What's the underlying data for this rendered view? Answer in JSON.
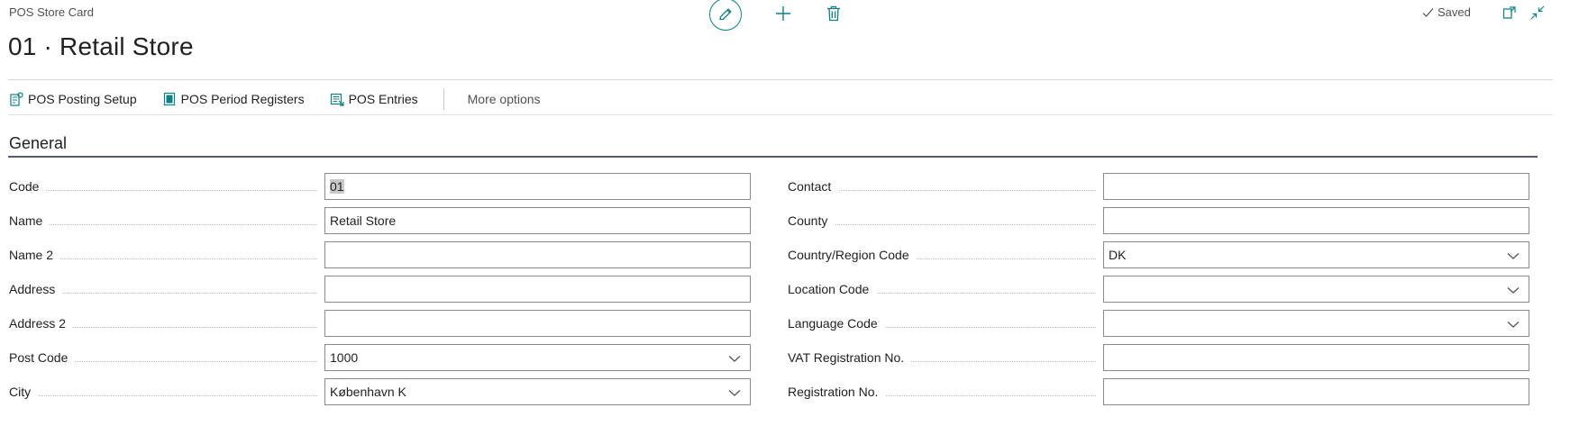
{
  "page": {
    "caption": "POS Store Card",
    "title": "01 · Retail Store",
    "status": "Saved"
  },
  "icons": {
    "edit": "pencil-icon",
    "new": "plus-icon",
    "delete": "trash-icon",
    "saved": "check-icon",
    "open_new_window": "open-in-new-window-icon",
    "collapse": "collapse-icon"
  },
  "actionbar": {
    "items": [
      {
        "label": "POS Posting Setup",
        "icon": "posting-setup-icon"
      },
      {
        "label": "POS Period Registers",
        "icon": "register-icon"
      },
      {
        "label": "POS Entries",
        "icon": "entries-icon"
      }
    ],
    "more": "More options"
  },
  "section": {
    "title": "General"
  },
  "fields_left": [
    {
      "label": "Code",
      "value": "01",
      "dropdown": false
    },
    {
      "label": "Name",
      "value": "Retail Store",
      "dropdown": false
    },
    {
      "label": "Name 2",
      "value": "",
      "dropdown": false
    },
    {
      "label": "Address",
      "value": "",
      "dropdown": false
    },
    {
      "label": "Address 2",
      "value": "",
      "dropdown": false
    },
    {
      "label": "Post Code",
      "value": "1000",
      "dropdown": true
    },
    {
      "label": "City",
      "value": "København K",
      "dropdown": true
    }
  ],
  "fields_right": [
    {
      "label": "Contact",
      "value": "",
      "dropdown": false
    },
    {
      "label": "County",
      "value": "",
      "dropdown": false
    },
    {
      "label": "Country/Region Code",
      "value": "DK",
      "dropdown": true
    },
    {
      "label": "Location Code",
      "value": "",
      "dropdown": true
    },
    {
      "label": "Language Code",
      "value": "",
      "dropdown": true
    },
    {
      "label": "VAT Registration No.",
      "value": "",
      "dropdown": false
    },
    {
      "label": "Registration No.",
      "value": "",
      "dropdown": false
    }
  ],
  "colors": {
    "accent": "#0f7f84",
    "section_line": "#505c6d",
    "field_border": "#8a8a8a"
  }
}
